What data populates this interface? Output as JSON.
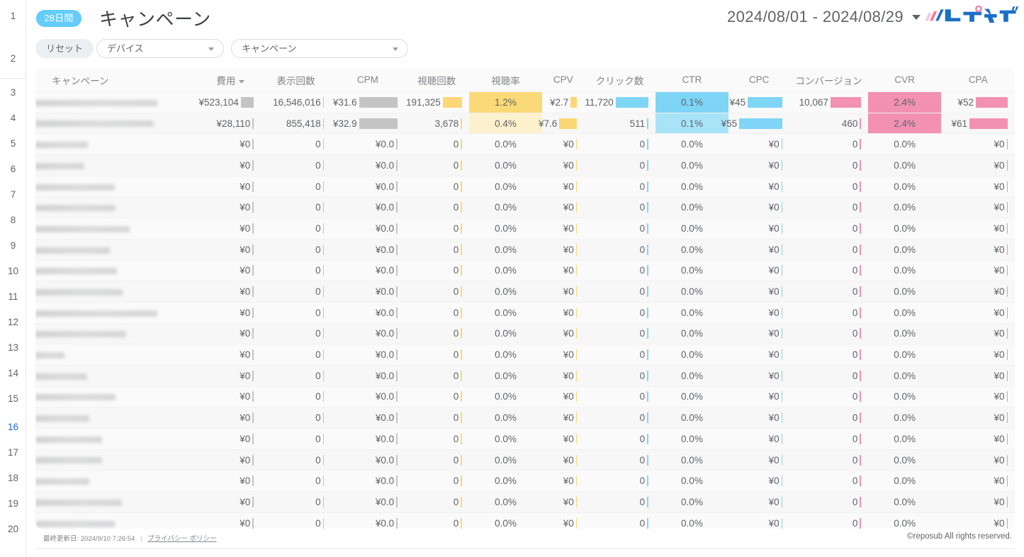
{
  "header": {
    "badge": "28日間",
    "title": "キャンペーン",
    "date_range": "2024/08/01 - 2024/08/29",
    "logo_text": "レポサブ"
  },
  "filters": {
    "reset_label": "リセット",
    "device": {
      "label": "デバイス"
    },
    "campaign": {
      "label": "キャンペーン"
    }
  },
  "table": {
    "columns": [
      {
        "key": "campaign",
        "label": "キャンペーン",
        "align": "left",
        "sorted": false
      },
      {
        "key": "cost",
        "label": "費用",
        "align": "center",
        "sorted": true
      },
      {
        "key": "impressions",
        "label": "表示回数",
        "align": "center",
        "sorted": false
      },
      {
        "key": "cpm",
        "label": "CPM",
        "align": "center",
        "sorted": false
      },
      {
        "key": "views",
        "label": "視聴回数",
        "align": "center",
        "sorted": false
      },
      {
        "key": "vr",
        "label": "視聴率",
        "align": "center",
        "sorted": false
      },
      {
        "key": "cpv",
        "label": "CPV",
        "align": "center",
        "sorted": false
      },
      {
        "key": "clicks",
        "label": "クリック数",
        "align": "center",
        "sorted": false
      },
      {
        "key": "ctr",
        "label": "CTR",
        "align": "center",
        "sorted": false
      },
      {
        "key": "cpc",
        "label": "CPC",
        "align": "center",
        "sorted": false
      },
      {
        "key": "conversions",
        "label": "コンバージョン",
        "align": "center",
        "sorted": false
      },
      {
        "key": "cvr",
        "label": "CVR",
        "align": "center",
        "sorted": false
      },
      {
        "key": "cpa",
        "label": "CPA",
        "align": "center",
        "sorted": false
      }
    ],
    "rows": [
      {
        "campaign": "",
        "redacted": true,
        "name_width": 172,
        "cost": "¥523,104",
        "cost_bar": 18,
        "impressions": "16,546,016",
        "impressions_bar": 1.5,
        "cpm": "¥31.6",
        "cpm_bar": 54,
        "views": "191,325",
        "views_bar": 27,
        "vr": "1.2%",
        "vr_heat": "#fada78",
        "cpv": "¥2.7",
        "cpv_bar": 9,
        "clicks": "11,720",
        "clicks_bar": 46,
        "ctr": "0.1%",
        "ctr_heat": "#7fd5f5",
        "cpc": "¥45",
        "cpc_bar": 49,
        "conversions": "10,067",
        "conversions_bar": 43,
        "cvr": "2.4%",
        "cvr_heat": "#f291b2",
        "cpa": "¥52",
        "cpa_bar": 45
      },
      {
        "campaign": "",
        "redacted": true,
        "name_width": 167,
        "cost": "¥28,110",
        "cost_bar": 1.5,
        "impressions": "855,418",
        "impressions_bar": 1.5,
        "cpm": "¥32.9",
        "cpm_bar": 54,
        "views": "3,678",
        "views_bar": 1.5,
        "vr": "0.4%",
        "vr_heat": "#fdf0cd",
        "cpv": "¥7.6",
        "cpv_bar": 25,
        "clicks": "511",
        "clicks_bar": 1.5,
        "ctr": "0.1%",
        "ctr_heat": "#a9e3f8",
        "cpc": "¥55",
        "cpc_bar": 61,
        "conversions": "460",
        "conversions_bar": 1.5,
        "cvr": "2.4%",
        "cvr_heat": "#f291b2",
        "cpa": "¥61",
        "cpa_bar": 54
      },
      {
        "campaign": "",
        "redacted": true,
        "name_width": 74,
        "cost": "¥0",
        "cost_bar": 1.5,
        "impressions": "0",
        "impressions_bar": 1.5,
        "cpm": "¥0.0",
        "cpm_bar": 1.5,
        "views": "0",
        "views_bar": 1.5,
        "vr": "0.0%",
        "vr_heat": "",
        "cpv": "¥0",
        "cpv_bar": 1.5,
        "clicks": "0",
        "clicks_bar": 1.5,
        "ctr": "0.0%",
        "ctr_heat": "",
        "cpc": "¥0",
        "cpc_bar": 1.5,
        "conversions": "0",
        "conversions_bar": 1.5,
        "cvr": "0.0%",
        "cvr_heat": "",
        "cpa": "¥0",
        "cpa_bar": 1.5
      },
      {
        "campaign": "",
        "redacted": true,
        "name_width": 69,
        "cost": "¥0",
        "cost_bar": 1.5,
        "impressions": "0",
        "impressions_bar": 1.5,
        "cpm": "¥0.0",
        "cpm_bar": 1.5,
        "views": "0",
        "views_bar": 1.5,
        "vr": "0.0%",
        "vr_heat": "",
        "cpv": "¥0",
        "cpv_bar": 1.5,
        "clicks": "0",
        "clicks_bar": 1.5,
        "ctr": "0.0%",
        "ctr_heat": "",
        "cpc": "¥0",
        "cpc_bar": 1.5,
        "conversions": "0",
        "conversions_bar": 1.5,
        "cvr": "0.0%",
        "cvr_heat": "",
        "cpa": "¥0",
        "cpa_bar": 1.5
      },
      {
        "campaign": "",
        "redacted": true,
        "name_width": 112,
        "cost": "¥0",
        "cost_bar": 1.5,
        "impressions": "0",
        "impressions_bar": 1.5,
        "cpm": "¥0.0",
        "cpm_bar": 1.5,
        "views": "0",
        "views_bar": 1.5,
        "vr": "0.0%",
        "vr_heat": "",
        "cpv": "¥0",
        "cpv_bar": 1.5,
        "clicks": "0",
        "clicks_bar": 1.5,
        "ctr": "0.0%",
        "ctr_heat": "",
        "cpc": "¥0",
        "cpc_bar": 1.5,
        "conversions": "0",
        "conversions_bar": 1.5,
        "cvr": "0.0%",
        "cvr_heat": "",
        "cpa": "¥0",
        "cpa_bar": 1.5
      },
      {
        "campaign": "",
        "redacted": true,
        "name_width": 113,
        "cost": "¥0",
        "cost_bar": 1.5,
        "impressions": "0",
        "impressions_bar": 1.5,
        "cpm": "¥0.0",
        "cpm_bar": 1.5,
        "views": "0",
        "views_bar": 1.5,
        "vr": "0.0%",
        "vr_heat": "",
        "cpv": "¥0",
        "cpv_bar": 1.5,
        "clicks": "0",
        "clicks_bar": 1.5,
        "ctr": "0.0%",
        "ctr_heat": "",
        "cpc": "¥0",
        "cpc_bar": 1.5,
        "conversions": "0",
        "conversions_bar": 1.5,
        "cvr": "0.0%",
        "cvr_heat": "",
        "cpa": "¥0",
        "cpa_bar": 1.5
      },
      {
        "campaign": "",
        "redacted": true,
        "name_width": 133,
        "cost": "¥0",
        "cost_bar": 1.5,
        "impressions": "0",
        "impressions_bar": 1.5,
        "cpm": "¥0.0",
        "cpm_bar": 1.5,
        "views": "0",
        "views_bar": 1.5,
        "vr": "0.0%",
        "vr_heat": "",
        "cpv": "¥0",
        "cpv_bar": 1.5,
        "clicks": "0",
        "clicks_bar": 1.5,
        "ctr": "0.0%",
        "ctr_heat": "",
        "cpc": "¥0",
        "cpc_bar": 1.5,
        "conversions": "0",
        "conversions_bar": 1.5,
        "cvr": "0.0%",
        "cvr_heat": "",
        "cpa": "¥0",
        "cpa_bar": 1.5
      },
      {
        "campaign": "",
        "redacted": true,
        "name_width": 105,
        "cost": "¥0",
        "cost_bar": 1.5,
        "impressions": "0",
        "impressions_bar": 1.5,
        "cpm": "¥0.0",
        "cpm_bar": 1.5,
        "views": "0",
        "views_bar": 1.5,
        "vr": "0.0%",
        "vr_heat": "",
        "cpv": "¥0",
        "cpv_bar": 1.5,
        "clicks": "0",
        "clicks_bar": 1.5,
        "ctr": "0.0%",
        "ctr_heat": "",
        "cpc": "¥0",
        "cpc_bar": 1.5,
        "conversions": "0",
        "conversions_bar": 1.5,
        "cvr": "0.0%",
        "cvr_heat": "",
        "cpa": "¥0",
        "cpa_bar": 1.5
      },
      {
        "campaign": "",
        "redacted": true,
        "name_width": 115,
        "cost": "¥0",
        "cost_bar": 1.5,
        "impressions": "0",
        "impressions_bar": 1.5,
        "cpm": "¥0.0",
        "cpm_bar": 1.5,
        "views": "0",
        "views_bar": 1.5,
        "vr": "0.0%",
        "vr_heat": "",
        "cpv": "¥0",
        "cpv_bar": 1.5,
        "clicks": "0",
        "clicks_bar": 1.5,
        "ctr": "0.0%",
        "ctr_heat": "",
        "cpc": "¥0",
        "cpc_bar": 1.5,
        "conversions": "0",
        "conversions_bar": 1.5,
        "cvr": "0.0%",
        "cvr_heat": "",
        "cpa": "¥0",
        "cpa_bar": 1.5
      },
      {
        "campaign": "",
        "redacted": true,
        "name_width": 123,
        "cost": "¥0",
        "cost_bar": 1.5,
        "impressions": "0",
        "impressions_bar": 1.5,
        "cpm": "¥0.0",
        "cpm_bar": 1.5,
        "views": "0",
        "views_bar": 1.5,
        "vr": "0.0%",
        "vr_heat": "",
        "cpv": "¥0",
        "cpv_bar": 1.5,
        "clicks": "0",
        "clicks_bar": 1.5,
        "ctr": "0.0%",
        "ctr_heat": "",
        "cpc": "¥0",
        "cpc_bar": 1.5,
        "conversions": "0",
        "conversions_bar": 1.5,
        "cvr": "0.0%",
        "cvr_heat": "",
        "cpa": "¥0",
        "cpa_bar": 1.5
      },
      {
        "campaign": "",
        "redacted": true,
        "name_width": 172,
        "cost": "¥0",
        "cost_bar": 1.5,
        "impressions": "0",
        "impressions_bar": 1.5,
        "cpm": "¥0.0",
        "cpm_bar": 1.5,
        "views": "0",
        "views_bar": 1.5,
        "vr": "0.0%",
        "vr_heat": "",
        "cpv": "¥0",
        "cpv_bar": 1.5,
        "clicks": "0",
        "clicks_bar": 1.5,
        "ctr": "0.0%",
        "ctr_heat": "",
        "cpc": "¥0",
        "cpc_bar": 1.5,
        "conversions": "0",
        "conversions_bar": 1.5,
        "cvr": "0.0%",
        "cvr_heat": "",
        "cpa": "¥0",
        "cpa_bar": 1.5
      },
      {
        "campaign": "",
        "redacted": true,
        "name_width": 128,
        "cost": "¥0",
        "cost_bar": 1.5,
        "impressions": "0",
        "impressions_bar": 1.5,
        "cpm": "¥0.0",
        "cpm_bar": 1.5,
        "views": "0",
        "views_bar": 1.5,
        "vr": "0.0%",
        "vr_heat": "",
        "cpv": "¥0",
        "cpv_bar": 1.5,
        "clicks": "0",
        "clicks_bar": 1.5,
        "ctr": "0.0%",
        "ctr_heat": "",
        "cpc": "¥0",
        "cpc_bar": 1.5,
        "conversions": "0",
        "conversions_bar": 1.5,
        "cvr": "0.0%",
        "cvr_heat": "",
        "cpa": "¥0",
        "cpa_bar": 1.5
      },
      {
        "campaign": "",
        "redacted": true,
        "name_width": 41,
        "cost": "¥0",
        "cost_bar": 1.5,
        "impressions": "0",
        "impressions_bar": 1.5,
        "cpm": "¥0.0",
        "cpm_bar": 1.5,
        "views": "0",
        "views_bar": 1.5,
        "vr": "0.0%",
        "vr_heat": "",
        "cpv": "¥0",
        "cpv_bar": 1.5,
        "clicks": "0",
        "clicks_bar": 1.5,
        "ctr": "0.0%",
        "ctr_heat": "",
        "cpc": "¥0",
        "cpc_bar": 1.5,
        "conversions": "0",
        "conversions_bar": 1.5,
        "cvr": "0.0%",
        "cvr_heat": "",
        "cpa": "¥0",
        "cpa_bar": 1.5
      },
      {
        "campaign": "",
        "redacted": true,
        "name_width": 73,
        "cost": "¥0",
        "cost_bar": 1.5,
        "impressions": "0",
        "impressions_bar": 1.5,
        "cpm": "¥0.0",
        "cpm_bar": 1.5,
        "views": "0",
        "views_bar": 1.5,
        "vr": "0.0%",
        "vr_heat": "",
        "cpv": "¥0",
        "cpv_bar": 1.5,
        "clicks": "0",
        "clicks_bar": 1.5,
        "ctr": "0.0%",
        "ctr_heat": "",
        "cpc": "¥0",
        "cpc_bar": 1.5,
        "conversions": "0",
        "conversions_bar": 1.5,
        "cvr": "0.0%",
        "cvr_heat": "",
        "cpa": "¥0",
        "cpa_bar": 1.5
      },
      {
        "campaign": "",
        "redacted": true,
        "name_width": 113,
        "cost": "¥0",
        "cost_bar": 1.5,
        "impressions": "0",
        "impressions_bar": 1.5,
        "cpm": "¥0.0",
        "cpm_bar": 1.5,
        "views": "0",
        "views_bar": 1.5,
        "vr": "0.0%",
        "vr_heat": "",
        "cpv": "¥0",
        "cpv_bar": 1.5,
        "clicks": "0",
        "clicks_bar": 1.5,
        "ctr": "0.0%",
        "ctr_heat": "",
        "cpc": "¥0",
        "cpc_bar": 1.5,
        "conversions": "0",
        "conversions_bar": 1.5,
        "cvr": "0.0%",
        "cvr_heat": "",
        "cpa": "¥0",
        "cpa_bar": 1.5
      },
      {
        "campaign": "",
        "redacted": true,
        "name_width": 76,
        "cost": "¥0",
        "cost_bar": 1.5,
        "impressions": "0",
        "impressions_bar": 1.5,
        "cpm": "¥0.0",
        "cpm_bar": 1.5,
        "views": "0",
        "views_bar": 1.5,
        "vr": "0.0%",
        "vr_heat": "",
        "cpv": "¥0",
        "cpv_bar": 1.5,
        "clicks": "0",
        "clicks_bar": 1.5,
        "ctr": "0.0%",
        "ctr_heat": "",
        "cpc": "¥0",
        "cpc_bar": 1.5,
        "conversions": "0",
        "conversions_bar": 1.5,
        "cvr": "0.0%",
        "cvr_heat": "",
        "cpa": "¥0",
        "cpa_bar": 1.5
      },
      {
        "campaign": "",
        "redacted": true,
        "name_width": 94,
        "cost": "¥0",
        "cost_bar": 1.5,
        "impressions": "0",
        "impressions_bar": 1.5,
        "cpm": "¥0.0",
        "cpm_bar": 1.5,
        "views": "0",
        "views_bar": 1.5,
        "vr": "0.0%",
        "vr_heat": "",
        "cpv": "¥0",
        "cpv_bar": 1.5,
        "clicks": "0",
        "clicks_bar": 1.5,
        "ctr": "0.0%",
        "ctr_heat": "",
        "cpc": "¥0",
        "cpc_bar": 1.5,
        "conversions": "0",
        "conversions_bar": 1.5,
        "cvr": "0.0%",
        "cvr_heat": "",
        "cpa": "¥0",
        "cpa_bar": 1.5
      },
      {
        "campaign": "",
        "redacted": true,
        "name_width": 94,
        "cost": "¥0",
        "cost_bar": 1.5,
        "impressions": "0",
        "impressions_bar": 1.5,
        "cpm": "¥0.0",
        "cpm_bar": 1.5,
        "views": "0",
        "views_bar": 1.5,
        "vr": "0.0%",
        "vr_heat": "",
        "cpv": "¥0",
        "cpv_bar": 1.5,
        "clicks": "0",
        "clicks_bar": 1.5,
        "ctr": "0.0%",
        "ctr_heat": "",
        "cpc": "¥0",
        "cpc_bar": 1.5,
        "conversions": "0",
        "conversions_bar": 1.5,
        "cvr": "0.0%",
        "cvr_heat": "",
        "cpa": "¥0",
        "cpa_bar": 1.5
      },
      {
        "campaign": "",
        "redacted": true,
        "name_width": 76,
        "cost": "¥0",
        "cost_bar": 1.5,
        "impressions": "0",
        "impressions_bar": 1.5,
        "cpm": "¥0.0",
        "cpm_bar": 1.5,
        "views": "0",
        "views_bar": 1.5,
        "vr": "0.0%",
        "vr_heat": "",
        "cpv": "¥0",
        "cpv_bar": 1.5,
        "clicks": "0",
        "clicks_bar": 1.5,
        "ctr": "0.0%",
        "ctr_heat": "",
        "cpc": "¥0",
        "cpc_bar": 1.5,
        "conversions": "0",
        "conversions_bar": 1.5,
        "cvr": "0.0%",
        "cvr_heat": "",
        "cpa": "¥0",
        "cpa_bar": 1.5
      },
      {
        "campaign": "",
        "redacted": true,
        "name_width": 122,
        "cost": "¥0",
        "cost_bar": 1.5,
        "impressions": "0",
        "impressions_bar": 1.5,
        "cpm": "¥0.0",
        "cpm_bar": 1.5,
        "views": "0",
        "views_bar": 1.5,
        "vr": "0.0%",
        "vr_heat": "",
        "cpv": "¥0",
        "cpv_bar": 1.5,
        "clicks": "0",
        "clicks_bar": 1.5,
        "ctr": "0.0%",
        "ctr_heat": "",
        "cpc": "¥0",
        "cpc_bar": 1.5,
        "conversions": "0",
        "conversions_bar": 1.5,
        "cvr": "0.0%",
        "cvr_heat": "",
        "cpa": "¥0",
        "cpa_bar": 1.5
      },
      {
        "campaign": "",
        "redacted": true,
        "name_width": 112,
        "cost": "¥0",
        "cost_bar": 1.5,
        "impressions": "0",
        "impressions_bar": 1.5,
        "cpm": "¥0.0",
        "cpm_bar": 1.5,
        "views": "0",
        "views_bar": 1.5,
        "vr": "0.0%",
        "vr_heat": "",
        "cpv": "¥0",
        "cpv_bar": 1.5,
        "clicks": "0",
        "clicks_bar": 1.5,
        "ctr": "0.0%",
        "ctr_heat": "",
        "cpc": "¥0",
        "cpc_bar": 1.5,
        "conversions": "0",
        "conversions_bar": 1.5,
        "cvr": "0.0%",
        "cvr_heat": "",
        "cpa": "¥0",
        "cpa_bar": 1.5
      }
    ]
  },
  "footer": {
    "last_updated": "最終更新日: 2024/9/10 7:26:54",
    "separator": "|",
    "privacy_policy": "プライバシー ポリシー",
    "copyright": "©reposub All rights reserved."
  },
  "gutter": {
    "rows": [
      "1",
      "2",
      "3",
      "4",
      "5",
      "6",
      "7",
      "8",
      "9",
      "10",
      "11",
      "12",
      "13",
      "14",
      "15",
      "16",
      "17",
      "18",
      "19",
      "20"
    ],
    "active": "16"
  },
  "colors": {
    "accent_blue": "#63ccfa",
    "bar_gray": "#c4c4c4",
    "bar_yellow": "#fcd775",
    "bar_blue": "#7fd5f5",
    "bar_pink": "#f291b2",
    "heat_yellow_strong": "#fada78",
    "heat_yellow_light": "#fdf0cd",
    "heat_blue_strong": "#7fd5f5",
    "heat_blue_light": "#a9e3f8",
    "heat_pink": "#f291b2"
  }
}
